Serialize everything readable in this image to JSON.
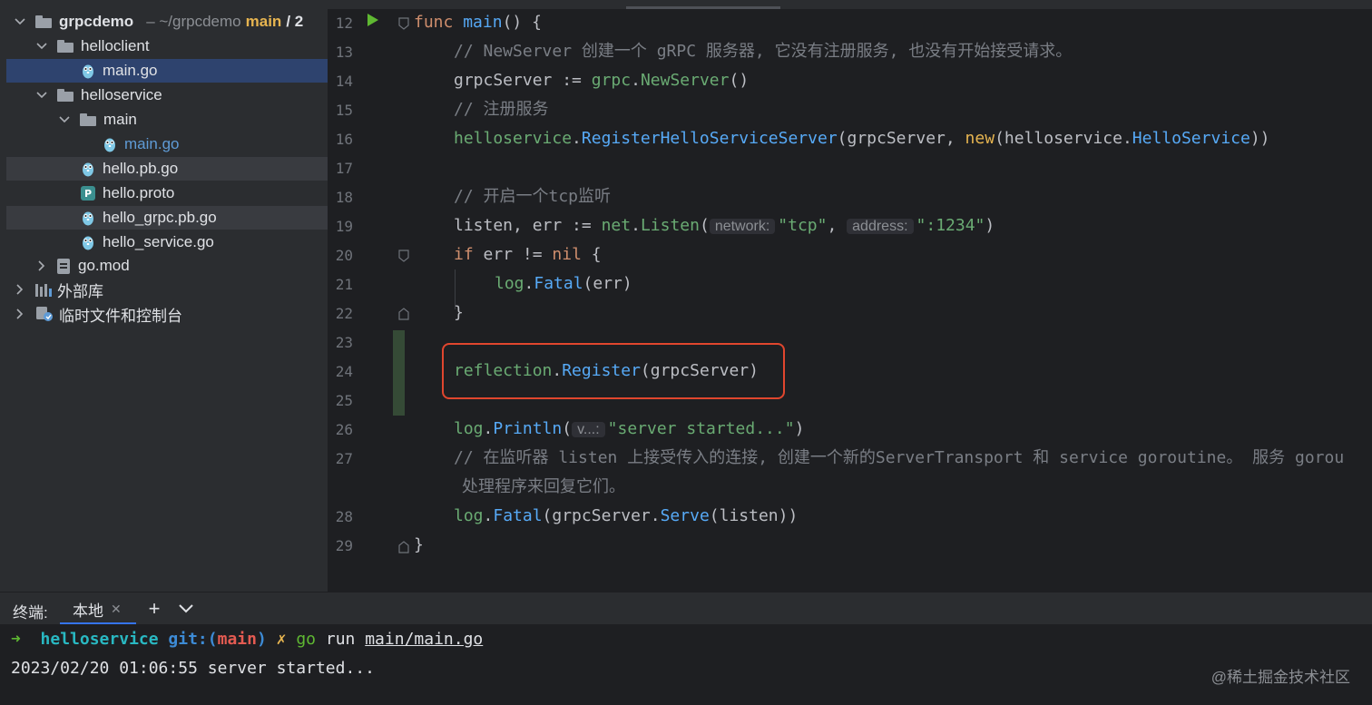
{
  "project_tree": {
    "root": {
      "name": "grpcdemo",
      "path": "~/grpcdemo",
      "branch": "main",
      "branch_suffix": "/ 2"
    },
    "items": [
      {
        "label": "helloclient"
      },
      {
        "label": "main.go"
      },
      {
        "label": "helloservice"
      },
      {
        "label": "main"
      },
      {
        "label": "main.go"
      },
      {
        "label": "hello.pb.go"
      },
      {
        "label": "hello.proto"
      },
      {
        "label": "hello_grpc.pb.go"
      },
      {
        "label": "hello_service.go"
      },
      {
        "label": "go.mod"
      },
      {
        "label": "外部库"
      },
      {
        "label": "临时文件和控制台"
      }
    ]
  },
  "editor": {
    "line_numbers": [
      "12",
      "13",
      "14",
      "15",
      "16",
      "17",
      "18",
      "19",
      "20",
      "21",
      "22",
      "23",
      "24",
      "25",
      "26",
      "27",
      "28",
      "29"
    ],
    "line12": {
      "kw": "func",
      "name": "main",
      "rest": "() {"
    },
    "line13": {
      "comment": "// NewServer 创建一个 gRPC 服务器, 它没有注册服务, 也没有开始接受请求。"
    },
    "line14": {
      "var": "grpcServer",
      "op": " := ",
      "pkg": "grpc",
      "dot": ".",
      "call": "NewServer",
      "rest": "()"
    },
    "line15": {
      "comment": "// 注册服务"
    },
    "line16": {
      "pkg": "helloservice",
      "dot": ".",
      "call": "RegisterHelloServiceServer",
      "open": "(grpcServer, ",
      "kw": "new",
      "open2": "(helloservice.",
      "type": "HelloService",
      "close": "))"
    },
    "line18": {
      "comment": "// 开启一个tcp监听"
    },
    "line19": {
      "vars": "listen, err",
      "op": " := ",
      "pkg": "net",
      "dot": ".",
      "call": "Listen",
      "open": "(",
      "hint1": "network:",
      "str1": "\"tcp\"",
      "comma": ", ",
      "hint2": "address:",
      "str2": "\":1234\"",
      "close": ")"
    },
    "line20": {
      "kw": "if",
      "cond": " err != ",
      "nil": "nil",
      "rest": " {"
    },
    "line21": {
      "pkg": "log",
      "dot": ".",
      "call": "Fatal",
      "rest": "(err)"
    },
    "line22": {
      "text": "}"
    },
    "line24": {
      "pkg": "reflection",
      "dot": ".",
      "call": "Register",
      "rest": "(grpcServer)"
    },
    "line26": {
      "pkg": "log",
      "dot": ".",
      "call": "Println",
      "open": "(",
      "hint": "v...:",
      "str": "\"server started...\"",
      "close": ")"
    },
    "line27": {
      "comment": "// 在监听器 listen 上接受传入的连接, 创建一个新的ServerTransport 和 service goroutine。 服务 gorou",
      "comment_wrap": "处理程序来回复它们。"
    },
    "line28": {
      "pkg": "log",
      "dot": ".",
      "call": "Fatal",
      "open": "(grpcServer.",
      "call2": "Serve",
      "rest": "(listen))"
    },
    "line29": {
      "text": "}"
    }
  },
  "terminal": {
    "title": "终端:",
    "tab_label": "本地",
    "prompt_arrow": "➜",
    "prompt_dir": "helloservice",
    "prompt_git": "git:(",
    "prompt_branch": "main",
    "prompt_git_close": ")",
    "prompt_x": "✗",
    "cmd_go": "go",
    "cmd_run": " run ",
    "cmd_path": "main/main.go",
    "output": "2023/02/20 01:06:55 server started..."
  },
  "watermark": "@稀土掘金技术社区",
  "colors": {
    "highlight_box": "#e0462e",
    "selection": "#2e436e",
    "accent": "#3574f0"
  }
}
